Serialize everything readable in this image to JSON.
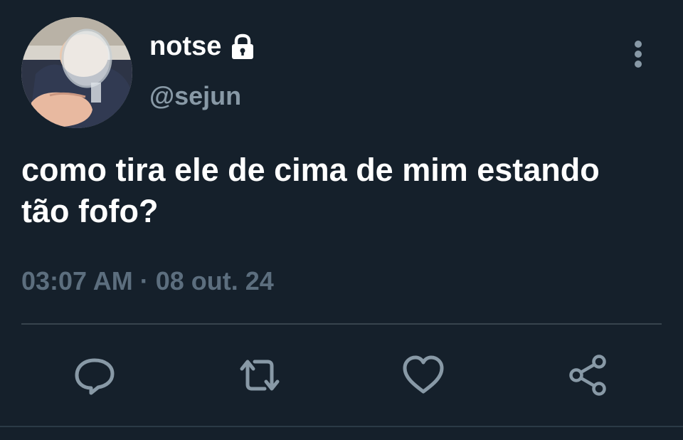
{
  "author": {
    "display_name": "notse",
    "handle": "@sejun",
    "protected_icon": "lock-icon"
  },
  "tweet": {
    "text": "como tira ele de cima de mim estando tão fofo?",
    "time": "03:07 AM",
    "separator": "·",
    "date": "08 out. 24"
  },
  "actions": {
    "reply_icon": "reply-icon",
    "retweet_icon": "retweet-icon",
    "like_icon": "heart-icon",
    "share_icon": "share-icon"
  },
  "colors": {
    "background": "#15202b",
    "primary_text": "#ffffff",
    "secondary_text": "#8899a6",
    "timestamp_text": "#5c6e7e",
    "divider": "#38444d",
    "icon": "#8899a6"
  }
}
